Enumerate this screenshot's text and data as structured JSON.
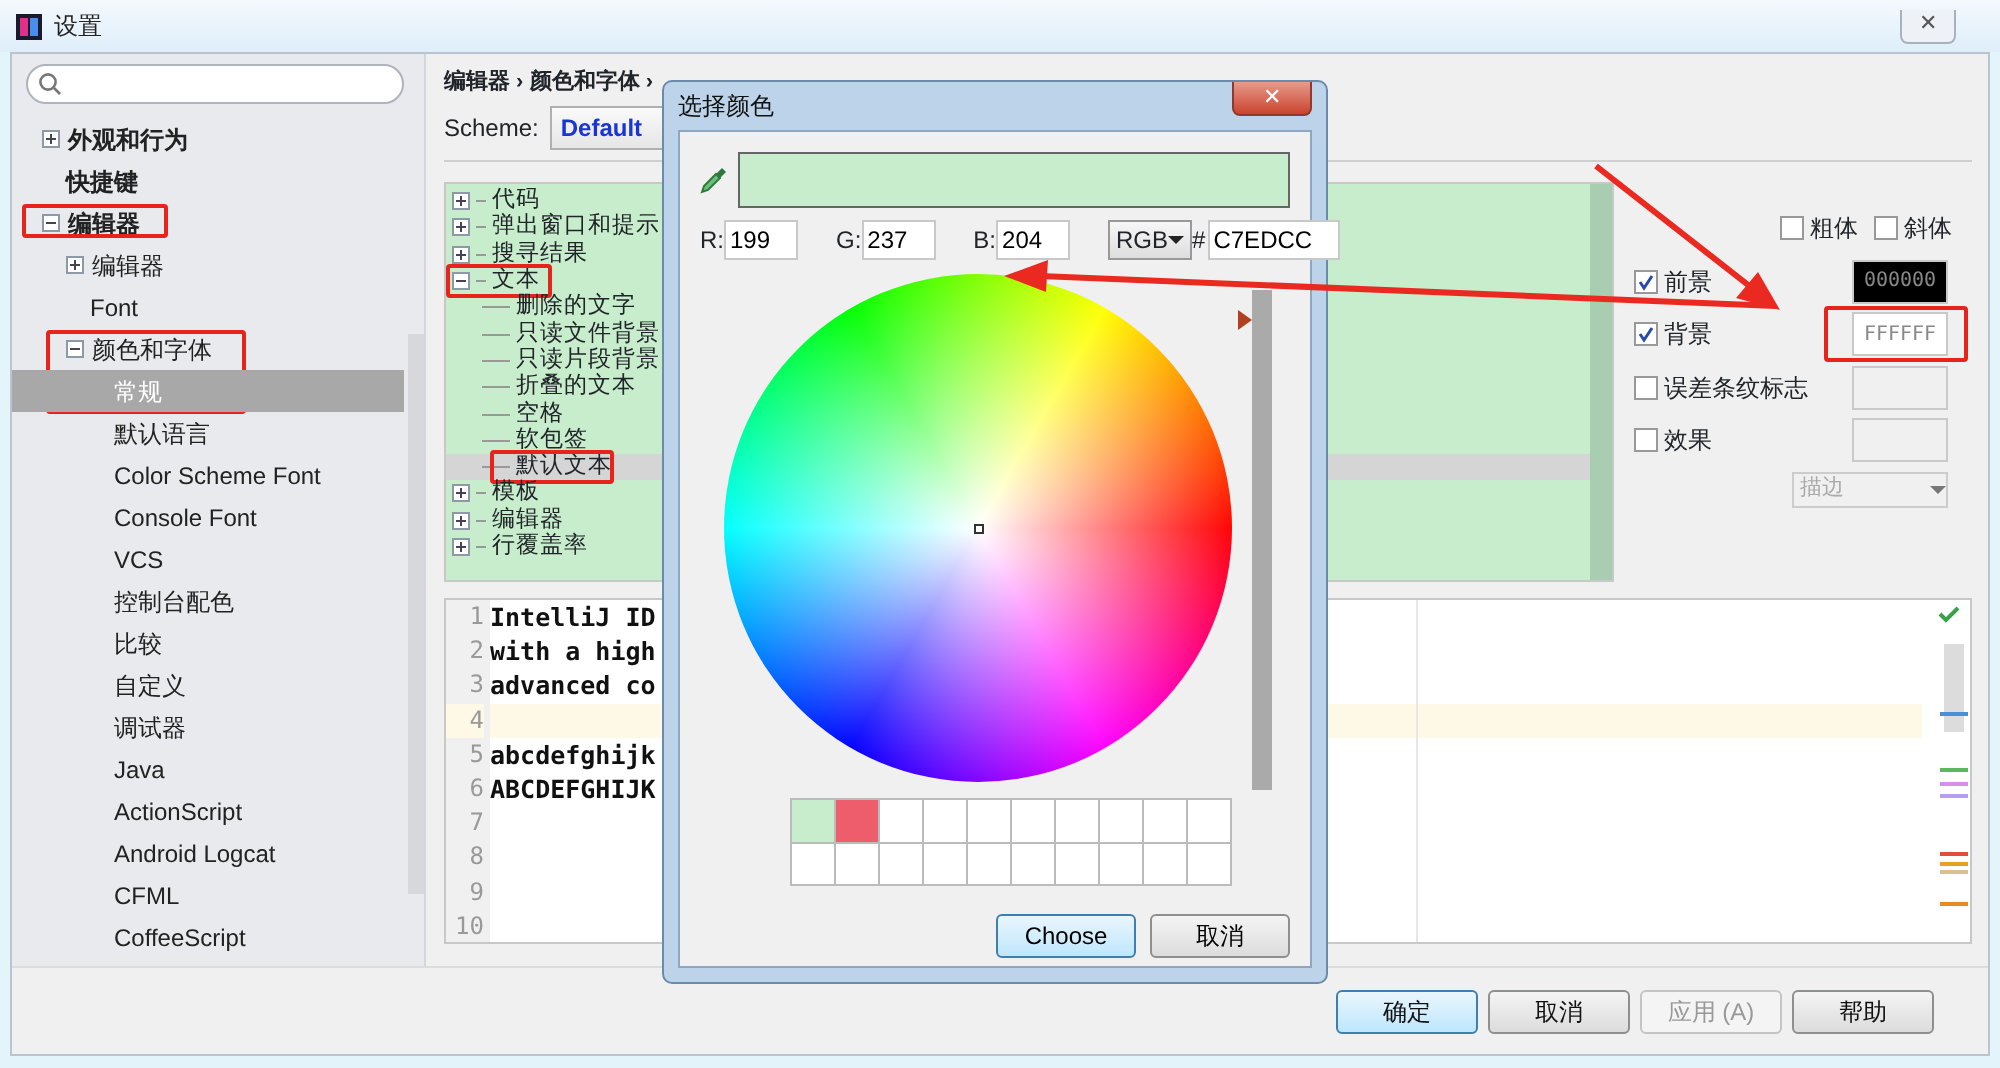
{
  "window": {
    "title": "设置",
    "close": "✕"
  },
  "settings_tree": [
    {
      "label": "外观和行为",
      "expanded": false,
      "selected": false
    },
    {
      "label": "快捷键",
      "selected": false
    },
    {
      "label": "编辑器",
      "expanded": true,
      "selected": false,
      "highlighted": true,
      "children": [
        {
          "label": "编辑器",
          "expanded": false,
          "selected": false
        },
        {
          "label": "Font",
          "selected": false
        },
        {
          "label": "颜色和字体",
          "expanded": true,
          "selected": false,
          "highlighted": true,
          "children": [
            {
              "label": "常规",
              "selected": true
            },
            {
              "label": "默认语言",
              "selected": false
            },
            {
              "label": "Color Scheme Font",
              "selected": false
            },
            {
              "label": "Console Font",
              "selected": false
            },
            {
              "label": "VCS",
              "selected": false
            },
            {
              "label": "控制台配色",
              "selected": false
            },
            {
              "label": "比较",
              "selected": false
            },
            {
              "label": "自定义",
              "selected": false
            },
            {
              "label": "调试器",
              "selected": false
            },
            {
              "label": "Java",
              "selected": false
            },
            {
              "label": "ActionScript",
              "selected": false
            },
            {
              "label": "Android Logcat",
              "selected": false
            },
            {
              "label": "CFML",
              "selected": false
            },
            {
              "label": "CoffeeScript",
              "selected": false
            }
          ]
        }
      ]
    }
  ],
  "breadcrumb": "编辑器 › 颜色和字体 ›",
  "scheme": {
    "label": "Scheme:",
    "value": "Default"
  },
  "color_tree": [
    {
      "label": "代码",
      "expanded": false,
      "selected": false
    },
    {
      "label": "弹出窗口和提示",
      "expanded": false,
      "selected": false
    },
    {
      "label": "搜寻结果",
      "expanded": false,
      "selected": false
    },
    {
      "label": "文本",
      "expanded": true,
      "selected": false,
      "highlighted": true,
      "children": [
        {
          "label": "删除的文字",
          "selected": false
        },
        {
          "label": "只读文件背景",
          "selected": false
        },
        {
          "label": "只读片段背景",
          "selected": false
        },
        {
          "label": "折叠的文本",
          "selected": false
        },
        {
          "label": "空格",
          "selected": false
        },
        {
          "label": "软包签",
          "selected": false
        },
        {
          "label": "默认文本",
          "selected": true,
          "highlighted": true
        }
      ]
    },
    {
      "label": "模板",
      "expanded": false,
      "selected": false
    },
    {
      "label": "编辑器",
      "expanded": false,
      "selected": false
    },
    {
      "label": "行覆盖率",
      "expanded": false,
      "selected": false
    }
  ],
  "font_style": [
    {
      "label": "粗体",
      "checked": false
    },
    {
      "label": "斜体",
      "checked": false
    }
  ],
  "attributes": [
    {
      "label": "前景",
      "checked": true,
      "value": "000000",
      "color": "#000000"
    },
    {
      "label": "背景",
      "checked": true,
      "value": "FFFFFF",
      "color": "#ffffff",
      "highlighted": true
    },
    {
      "label": "误差条纹标志",
      "checked": false
    },
    {
      "label": "效果",
      "checked": false
    }
  ],
  "effect_dropdown": {
    "value": "描边",
    "disabled": true
  },
  "preview": {
    "lines": [
      {
        "number": "1",
        "text": "IntelliJ ID",
        "current": false
      },
      {
        "number": "2",
        "text": "with a high",
        "current": false
      },
      {
        "number": "3",
        "text": "advanced co",
        "current": false
      },
      {
        "number": "4",
        "current": true
      },
      {
        "number": "5",
        "text": "abcdefghijk",
        "current": false
      },
      {
        "number": "6",
        "text": "ABCDEFGHIJK",
        "current": false
      },
      {
        "number": "7",
        "current": false
      },
      {
        "number": "8",
        "current": false
      },
      {
        "number": "9",
        "current": false
      },
      {
        "number": "10",
        "current": false
      }
    ]
  },
  "buttons": [
    {
      "label": "确定",
      "kind": "default",
      "disabled": false
    },
    {
      "label": "取消",
      "kind": "normal",
      "disabled": false
    },
    {
      "label": "应用 (A)",
      "kind": "normal",
      "disabled": true
    },
    {
      "label": "帮助",
      "kind": "normal",
      "disabled": false
    }
  ],
  "color_dialog": {
    "title": "选择颜色",
    "close": "✕",
    "preview": {
      "color": "#c7edcc"
    },
    "channels": [
      {
        "label": "R:",
        "value": "199"
      },
      {
        "label": "G:",
        "value": "237"
      },
      {
        "label": "B:",
        "value": "204"
      }
    ],
    "mode": "RGB",
    "hash": "#",
    "hex": "C7EDCC",
    "brightness": {
      "level": 0.94
    },
    "recent_colors": [
      {
        "color": "#c7edcc"
      },
      {
        "color": "#ee5d6c"
      }
    ],
    "buttons": [
      {
        "label": "Choose",
        "kind": "default"
      },
      {
        "label": "取消",
        "kind": "normal"
      }
    ]
  }
}
